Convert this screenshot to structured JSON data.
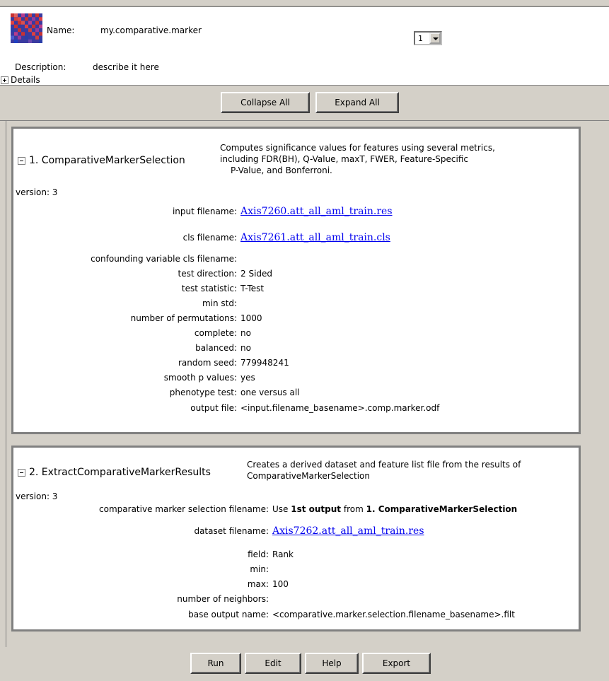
{
  "header": {
    "name_label": "Name:",
    "name_value": "my.comparative.marker",
    "description_label": "Description:",
    "description_value": "describe it here",
    "details_label": "Details",
    "version_select": "1",
    "logo_colors": [
      "#c83232",
      "#2a3ea8",
      "#b83c8c",
      "#e04040",
      "#3040a0",
      "#9a3a9a"
    ]
  },
  "toolbar": {
    "collapse_all": "Collapse All",
    "expand_all": "Expand All"
  },
  "tasks": [
    {
      "title": "1. ComparativeMarkerSelection",
      "description": [
        "Computes significance values for features using several metrics,",
        "including FDR(BH), Q-Value, maxT, FWER, Feature-Specific",
        "P-Value, and Bonferroni."
      ],
      "version": "version: 3",
      "params": [
        {
          "label": "input filename:",
          "value": "Axis7260.att_all_aml_train.res",
          "link": true
        },
        {
          "label": "cls filename:",
          "value": "Axis7261.att_all_aml_train.cls",
          "link": true
        },
        {
          "label": "confounding variable cls filename:",
          "value": ""
        },
        {
          "label": "test direction:",
          "value": "2 Sided"
        },
        {
          "label": "test statistic:",
          "value": "T-Test"
        },
        {
          "label": "min std:",
          "value": ""
        },
        {
          "label": "number of permutations:",
          "value": "1000"
        },
        {
          "label": "complete:",
          "value": "no"
        },
        {
          "label": "balanced:",
          "value": "no"
        },
        {
          "label": "random seed:",
          "value": "779948241"
        },
        {
          "label": "smooth p values:",
          "value": "yes"
        },
        {
          "label": "phenotype test:",
          "value": "one versus all"
        },
        {
          "label": "output file:",
          "value": "<input.filename_basename>.comp.marker.odf"
        }
      ]
    },
    {
      "title": "2. ExtractComparativeMarkerResults",
      "description": [
        "Creates a derived dataset and feature list file from the results of",
        "ComparativeMarkerSelection"
      ],
      "version": "version: 3",
      "params": [
        {
          "label": "comparative marker selection filename:",
          "value_parts": [
            "Use ",
            "1st output",
            " from ",
            "1. ComparativeMarkerSelection"
          ]
        },
        {
          "label": "dataset filename:",
          "value": "Axis7262.att_all_aml_train.res",
          "link": true
        },
        {
          "label": "field:",
          "value": "Rank"
        },
        {
          "label": "min:",
          "value": ""
        },
        {
          "label": "max:",
          "value": "100"
        },
        {
          "label": "number of neighbors:",
          "value": ""
        },
        {
          "label": "base output name:",
          "value": "<comparative.marker.selection.filename_basename>.filt"
        }
      ]
    }
  ],
  "footer": {
    "run": "Run",
    "edit": "Edit",
    "help": "Help",
    "export": "Export"
  }
}
